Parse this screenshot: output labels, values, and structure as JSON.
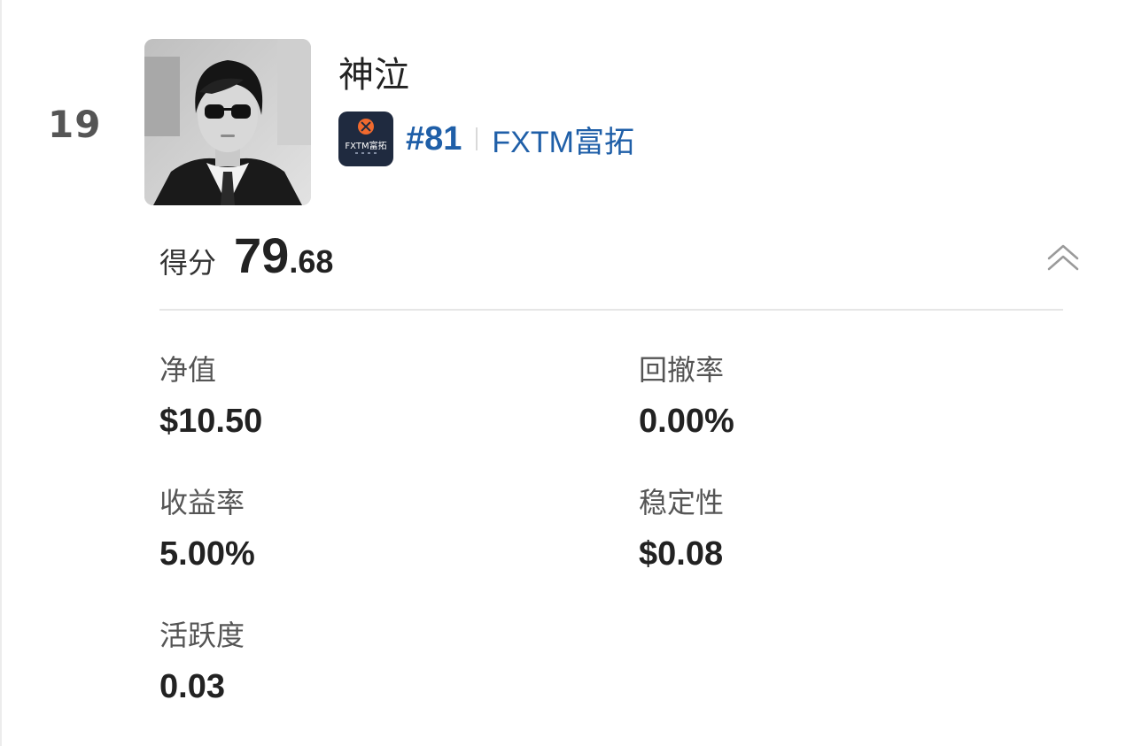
{
  "entry": {
    "rank": "19",
    "trader_name": "神泣",
    "avatar_icon": "trader-avatar-photo",
    "broker": {
      "logo_icon": "fxtm-logo-icon",
      "logo_text": "FXTM富拓",
      "rank": "#81",
      "name": "FXTM富拓",
      "color": "#1f5fa8",
      "logo_bg": "#1f2a3f",
      "logo_accent": "#f26a2e"
    },
    "score": {
      "label": "得分",
      "integer": "79",
      "decimal": ".68"
    },
    "collapse_icon": "double-chevron-up-icon",
    "metrics": {
      "net_value": {
        "label": "净值",
        "value": "$10.50"
      },
      "drawdown": {
        "label": "回撤率",
        "value": "0.00%"
      },
      "return_rate": {
        "label": "收益率",
        "value": "5.00%"
      },
      "stability": {
        "label": "稳定性",
        "value": "$0.08"
      },
      "activity": {
        "label": "活跃度",
        "value": "0.03"
      }
    }
  }
}
